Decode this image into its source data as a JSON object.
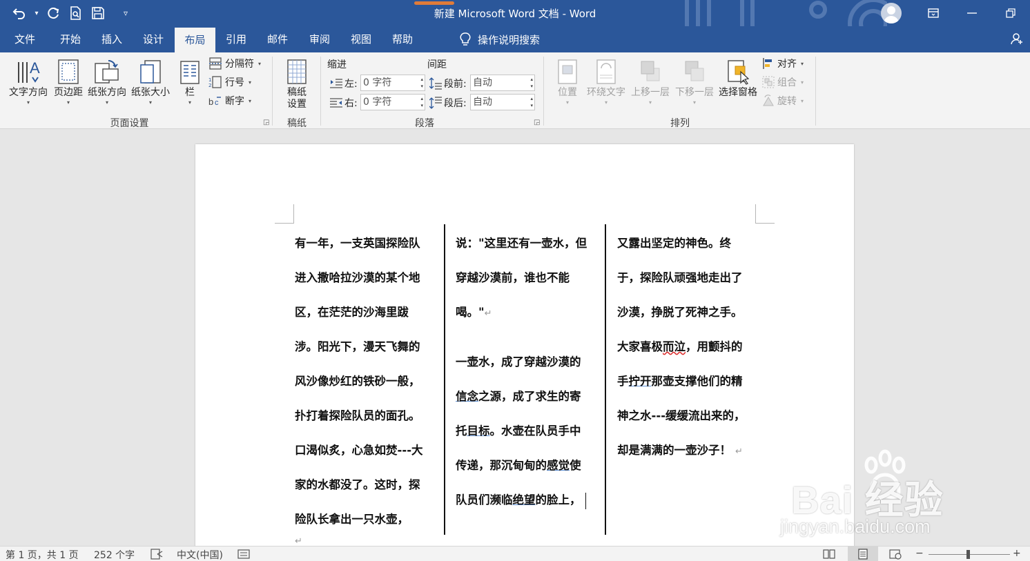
{
  "window": {
    "title": "新建 Microsoft Word 文档  -  Word"
  },
  "quick_access": {
    "undo_icon": "undo-icon",
    "redo_icon": "redo-icon",
    "print_preview_icon": "print-preview-icon",
    "save_icon": "save-icon",
    "customize_icon": "customize-qat-icon"
  },
  "tabs": [
    {
      "label": "文件"
    },
    {
      "label": "开始"
    },
    {
      "label": "插入"
    },
    {
      "label": "设计"
    },
    {
      "label": "布局"
    },
    {
      "label": "引用"
    },
    {
      "label": "邮件"
    },
    {
      "label": "审阅"
    },
    {
      "label": "视图"
    },
    {
      "label": "帮助"
    }
  ],
  "active_tab": "布局",
  "tell_me": {
    "label": "操作说明搜索"
  },
  "ribbon": {
    "page_setup": {
      "group_label": "页面设置",
      "text_direction": "文字方向",
      "margins": "页边距",
      "orientation": "纸张方向",
      "size": "纸张大小",
      "columns": "栏",
      "breaks": "分隔符",
      "line_numbers": "行号",
      "hyphenation": "断字"
    },
    "manuscript": {
      "group_label": "稿纸",
      "setup_line1": "稿纸",
      "setup_line2": "设置"
    },
    "paragraph": {
      "group_label": "段落",
      "indent_header": "缩进",
      "spacing_header": "间距",
      "left_label": "左:",
      "right_label": "右:",
      "left_value": "0 字符",
      "right_value": "0 字符",
      "before_label": "段前:",
      "after_label": "段后:",
      "before_value": "自动",
      "after_value": "自动"
    },
    "arrange": {
      "group_label": "排列",
      "position": "位置",
      "wrap_text": "环绕文字",
      "bring_forward": "上移一层",
      "send_backward": "下移一层",
      "selection_pane": "选择窗格",
      "align": "对齐",
      "group": "组合",
      "rotate": "旋转"
    }
  },
  "document": {
    "col1": [
      "有一年，一支英国探险队",
      "进入撒哈拉沙漠的某个地",
      "区，在茫茫的沙海里跋",
      "涉。阳光下，漫天飞舞的",
      "风沙像炒红的铁砂一般，",
      "扑打着探险队员的面孔。",
      "口渴似炙，心急如焚---大",
      "家的水都没了。这时，探",
      "险队长拿出一只水壶，"
    ],
    "col2": {
      "l1": "说：\"这里还有一壶水，但",
      "l2": "穿越沙漠前，谁也不能",
      "l3": "喝。\"",
      "l4": "一壶水，成了穿越沙漠的",
      "l5a": "信念",
      "l5b": "之源，成了求生的寄",
      "l6a": "托",
      "l6b": "目标",
      "l6c": "。水壶在队员手中",
      "l7a": "传递，那沉甸甸的",
      "l7b": "感觉",
      "l7c": "使",
      "l8a": "队员们濒临",
      "l8b": "绝望",
      "l8c": "的脸上，"
    },
    "col3": {
      "l1": "又露出坚定的神色。终",
      "l2": "于，探险队顽强地走出了",
      "l3": "沙漠，挣脱了死神之手。",
      "l4a": "大家喜极",
      "l4b": "而泣",
      "l4c": "，用颤抖的",
      "l5a": "手",
      "l5b": "拧开",
      "l5c": "那壶支撑他们的精",
      "l6": "神之水---缓缓流出来的，",
      "l7": "却是满满的一壶沙子！"
    },
    "pilcrow": "↵"
  },
  "watermark": {
    "main": "Bai 经验",
    "sub": "jingyan.baidu.com"
  },
  "status": {
    "page": "第 1 页，共 1 页",
    "words": "252 个字",
    "language": "中文(中国)"
  },
  "colors": {
    "brand": "#2b579a",
    "ribbon": "#f3f3f3",
    "canvas": "#e6e6e6"
  }
}
